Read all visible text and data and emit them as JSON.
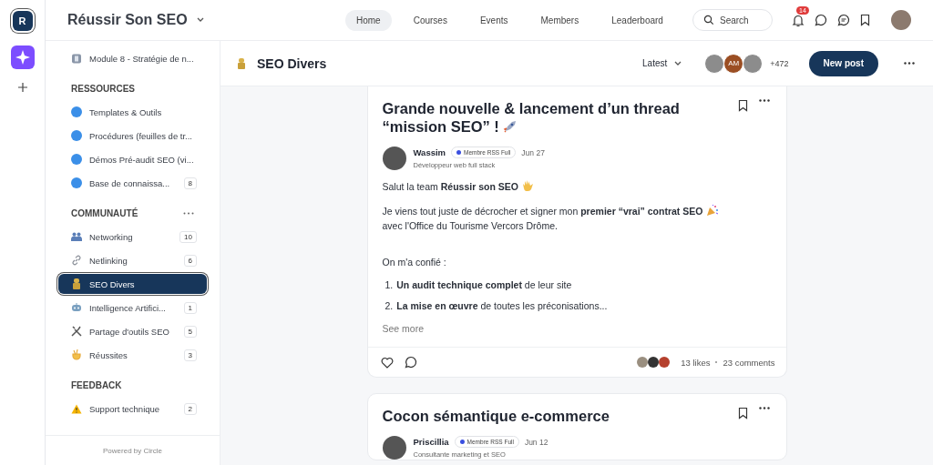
{
  "rail": {
    "logo": "R"
  },
  "header": {
    "community": "Réussir Son SEO",
    "nav": [
      {
        "label": "Home",
        "selected": true
      },
      {
        "label": "Courses",
        "selected": false
      },
      {
        "label": "Events",
        "selected": false
      },
      {
        "label": "Members",
        "selected": false
      },
      {
        "label": "Leaderboard",
        "selected": false
      }
    ],
    "search": {
      "placeholder": "Search"
    },
    "notifications": "14"
  },
  "sidebar": {
    "pinned": {
      "label": "Module 8 - Stratégie de n...",
      "selected": false
    },
    "sections": [
      {
        "title": "RESSOURCES",
        "items": [
          {
            "label": "Templates & Outils",
            "kind": "dot",
            "color": "#3b8fe8",
            "selected": false
          },
          {
            "label": "Procédures (feuilles de tr...",
            "kind": "dot",
            "color": "#3b8fe8",
            "selected": false
          },
          {
            "label": "Démos Pré-audit SEO (vi...",
            "kind": "dot",
            "color": "#3b8fe8",
            "selected": false
          },
          {
            "label": "Base de connaissa...",
            "count": "8",
            "kind": "dot",
            "color": "#3b8fe8",
            "selected": false
          }
        ]
      },
      {
        "title": "COMMUNAUTÉ",
        "items": [
          {
            "label": "Networking",
            "count": "10",
            "kind": "emoji",
            "selected": false
          },
          {
            "label": "Netlinking",
            "count": "6",
            "kind": "emoji",
            "selected": false
          },
          {
            "label": "SEO Divers",
            "kind": "emoji",
            "selected": true
          },
          {
            "label": "Intelligence Artifici...",
            "count": "1",
            "kind": "emoji",
            "selected": false
          },
          {
            "label": "Partage d'outils SEO",
            "count": "5",
            "kind": "emoji",
            "selected": false
          },
          {
            "label": "Réussites",
            "count": "3",
            "kind": "emoji",
            "selected": false
          }
        ]
      },
      {
        "title": "FEEDBACK",
        "items": [
          {
            "label": "Support technique",
            "count": "2",
            "kind": "emoji",
            "selected": false
          }
        ]
      }
    ],
    "footer": "Powered by Circle"
  },
  "space": {
    "title": "SEO Divers",
    "sort": "Latest",
    "avatars": [
      {
        "kind": "photo"
      },
      {
        "kind": "initials",
        "initials": "AM"
      },
      {
        "kind": "photo"
      }
    ],
    "extra_members": "+472",
    "new_post": "New post"
  },
  "posts": [
    {
      "title": "Grande nouvelle & lancement d’un thread “mission SEO” !",
      "author": "Wassim",
      "badge": "Membre RSS Full",
      "date": "Jun 27",
      "role": "Développeur web full stack",
      "body": [
        {
          "kind": "p",
          "text": "Salut la team **Réussir son SEO**"
        },
        {
          "kind": "p",
          "text": "Je viens tout juste de décrocher et signer mon **premier “vrai” contrat SEO**"
        },
        {
          "kind": "p",
          "text": "avec l'Office du Tourisme Vercors Drôme."
        },
        {
          "kind": "gap"
        },
        {
          "kind": "p",
          "text": "On m'a confié :"
        },
        {
          "kind": "li",
          "num": "1.",
          "text": "**Un audit technique complet** de leur site"
        },
        {
          "kind": "li",
          "num": "2.",
          "text": "**La mise en œuvre** de toutes les préconisations..."
        }
      ],
      "see_more": "See more",
      "likes": "13 likes",
      "comments": "23 comments"
    },
    {
      "title": "Cocon sémantique e-commerce",
      "author": "Priscillia",
      "badge": "Membre RSS Full",
      "date": "Jun 12",
      "role": "Consultante marketing et SEO"
    }
  ]
}
